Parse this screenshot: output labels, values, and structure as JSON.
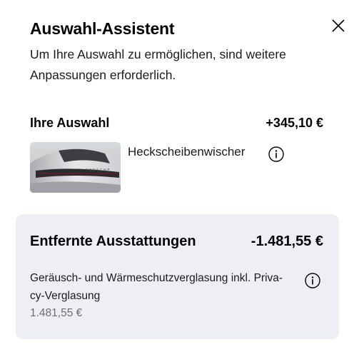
{
  "dialog": {
    "title": "Auswahl-Assistent",
    "subtitle": "Um Ihre Auswahl zu ermöglichen, sind weitere Anpassungen erforderlich."
  },
  "selection": {
    "label": "Ihre Auswahl",
    "price": "+345,10 €",
    "item": {
      "name": "Heckscheibenwischer",
      "icon": "info-icon",
      "image": "rear-car-thumbnail"
    }
  },
  "removed": {
    "label": "Entfernte Ausstattungen",
    "price": "-1.481,55 €",
    "item": {
      "name": "Geräusch- und Wärmeschutzverglasung inkl. Priva-cy-Verglasung",
      "price": "1.481,55 €",
      "icon": "info-icon"
    }
  },
  "colors": {
    "text": "#010205",
    "panel": "#eeeff2",
    "muted": "#6b6d70"
  }
}
